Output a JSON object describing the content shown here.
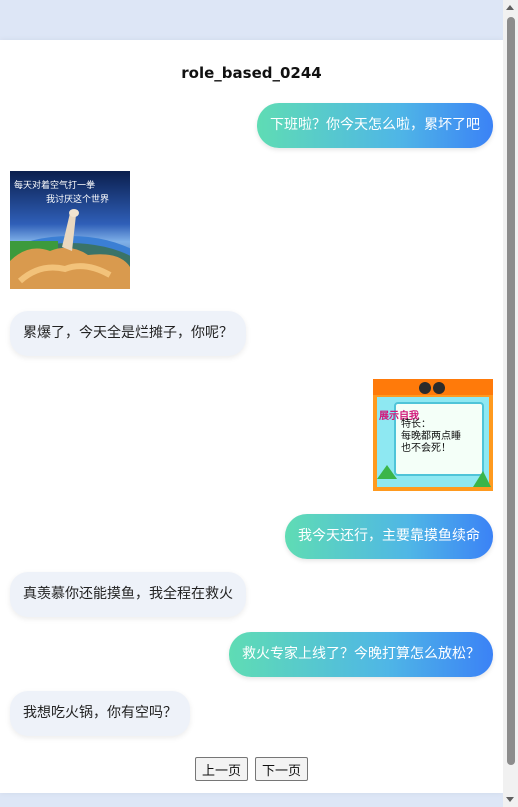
{
  "page": {
    "title": "role_based_0244"
  },
  "messages": [
    {
      "role": "user",
      "type": "text",
      "text": "下班啦？你今天怎么啦，累坏了吧"
    },
    {
      "role": "assistant",
      "type": "image",
      "icon": "cat-meme-image",
      "caption_top": "每天对着空气打一拳",
      "caption_bottom": "我讨厌这个世界"
    },
    {
      "role": "assistant",
      "type": "text",
      "text": "累爆了，今天全是烂摊子，你呢？"
    },
    {
      "role": "user",
      "type": "image",
      "icon": "meme-card-image",
      "side_text": "展示自我",
      "body_line1": "特长：",
      "body_line2": "每晚都两点睡",
      "body_line3": "也不会死！"
    },
    {
      "role": "user",
      "type": "text",
      "text": "我今天还行，主要靠摸鱼续命"
    },
    {
      "role": "assistant",
      "type": "text",
      "text": "真羡慕你还能摸鱼，我全程在救火"
    },
    {
      "role": "user",
      "type": "text",
      "text": "救火专家上线了？今晚打算怎么放松？"
    },
    {
      "role": "assistant",
      "type": "text",
      "text": "我想吃火锅，你有空吗？"
    }
  ],
  "nav": {
    "prev_label": "上一页",
    "next_label": "下一页"
  },
  "colors": {
    "user_gradient_start": "#5fdcb4",
    "user_gradient_end": "#3b82f6",
    "assistant_bg": "#eef2f9"
  }
}
